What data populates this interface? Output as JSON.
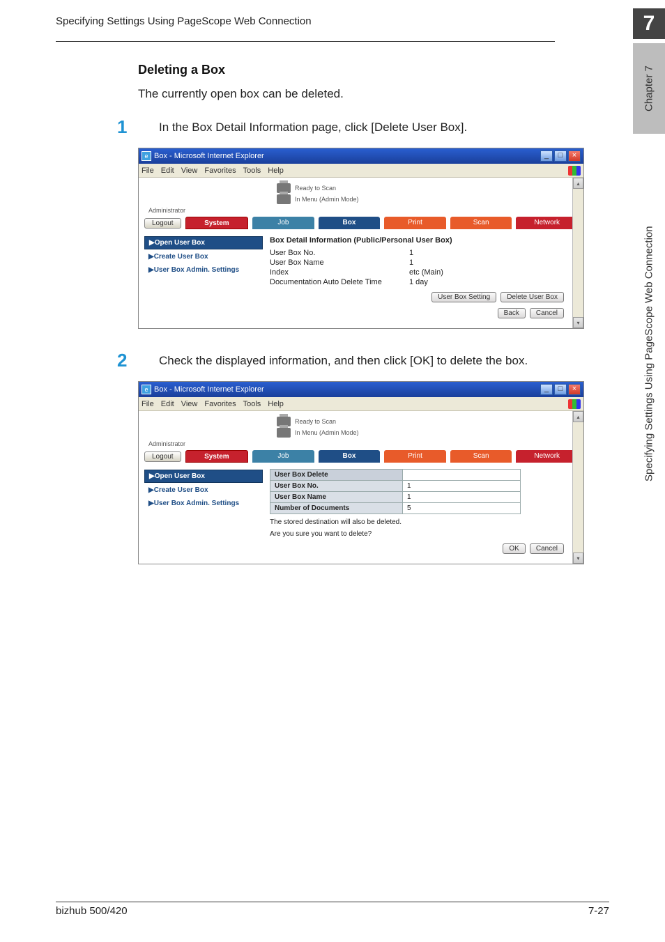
{
  "header": {
    "running_title": "Specifying Settings Using PageScope Web Connection",
    "chapter_num": "7"
  },
  "side": {
    "chapter_label": "Chapter 7",
    "vertical_label": "Specifying Settings Using PageScope Web Connection"
  },
  "section": {
    "title": "Deleting a Box",
    "intro": "The currently open box can be deleted."
  },
  "steps": [
    {
      "num": "1",
      "text": "In the Box Detail Information page, click [Delete User Box]."
    },
    {
      "num": "2",
      "text": "Check the displayed information, and then click [OK] to delete the box."
    }
  ],
  "window": {
    "title": "Box - Microsoft Internet Explorer",
    "menus": [
      "File",
      "Edit",
      "View",
      "Favorites",
      "Tools",
      "Help"
    ],
    "status_ready": "Ready to Scan",
    "status_menu": "In Menu (Admin Mode)",
    "admin_label": "Administrator",
    "logout": "Logout",
    "tabs": {
      "system": "System",
      "job": "Job",
      "box": "Box",
      "print": "Print",
      "scan": "Scan",
      "network": "Network"
    },
    "side_menu": {
      "open": "▶Open User Box",
      "create": "▶Create User Box",
      "admin_settings": "▶User Box Admin. Settings"
    }
  },
  "screenshot1": {
    "panel_title": "Box Detail Information (Public/Personal User Box)",
    "rows": [
      {
        "k": "User Box No.",
        "v": "1"
      },
      {
        "k": "User Box Name",
        "v": "1"
      },
      {
        "k": "Index",
        "v": "etc (Main)"
      },
      {
        "k": "Documentation Auto Delete Time",
        "v": "1 day"
      }
    ],
    "buttons": {
      "setting": "User Box Setting",
      "delete": "Delete User Box",
      "back": "Back",
      "cancel": "Cancel"
    }
  },
  "screenshot2": {
    "panel_title": "User Box Delete",
    "rows": [
      {
        "k": "User Box No.",
        "v": "1"
      },
      {
        "k": "User Box Name",
        "v": "1"
      },
      {
        "k": "Number of Documents",
        "v": "5"
      }
    ],
    "note1": "The stored destination will also be deleted.",
    "note2": "Are you sure you want to delete?",
    "buttons": {
      "ok": "OK",
      "cancel": "Cancel"
    }
  },
  "footer": {
    "product": "bizhub 500/420",
    "page": "7-27"
  }
}
